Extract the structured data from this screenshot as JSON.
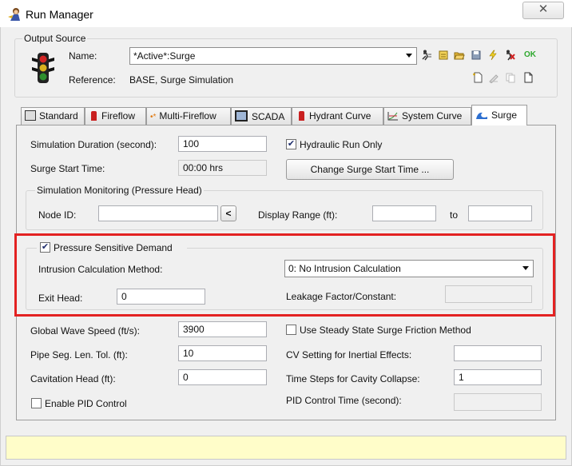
{
  "window": {
    "title": "Run Manager",
    "close_glyph": "✕"
  },
  "output_source": {
    "legend": "Output Source",
    "name_label": "Name:",
    "name_value": "*Active*:Surge",
    "reference_label": "Reference:",
    "reference_value": "BASE, Surge Simulation",
    "ok_label": "OK"
  },
  "tabs": [
    {
      "label": "Standard",
      "icon": "calculator-icon"
    },
    {
      "label": "Fireflow",
      "icon": "hydrant-icon"
    },
    {
      "label": "Multi-Fireflow",
      "icon": "multi-fireflow-icon"
    },
    {
      "label": "SCADA",
      "icon": "monitor-icon"
    },
    {
      "label": "Hydrant Curve",
      "icon": "hydrant-icon"
    },
    {
      "label": "System Curve",
      "icon": "chart-icon"
    },
    {
      "label": "Surge",
      "icon": "wave-icon"
    }
  ],
  "surge": {
    "sim_duration_label": "Simulation Duration (second):",
    "sim_duration_value": "100",
    "hydraulic_only_label": "Hydraulic Run Only",
    "surge_start_label": "Surge Start Time:",
    "surge_start_value": "00:00 hrs",
    "change_start_button": "Change Surge Start Time ...",
    "monitoring_legend": "Simulation Monitoring (Pressure Head)",
    "node_id_label": "Node ID:",
    "node_id_button": "<",
    "display_range_label": "Display Range (ft):",
    "to_label": "to",
    "psd_label": "Pressure Sensitive Demand",
    "intrusion_label": "Intrusion Calculation Method:",
    "intrusion_value": "0: No Intrusion Calculation",
    "exit_head_label": "Exit Head:",
    "exit_head_value": "0",
    "leakage_label": "Leakage Factor/Constant:",
    "wave_speed_label": "Global Wave Speed (ft/s):",
    "wave_speed_value": "3900",
    "steady_friction_label": "Use Steady State Surge Friction Method",
    "pipe_seg_label": "Pipe Seg. Len. Tol. (ft):",
    "pipe_seg_value": "10",
    "cv_setting_label": "CV Setting for Inertial Effects:",
    "cavitation_label": "Cavitation Head (ft):",
    "cavitation_value": "0",
    "time_steps_label": "Time Steps for Cavity Collapse:",
    "time_steps_value": "1",
    "pid_enable_label": "Enable PID Control",
    "pid_time_label": "PID Control Time (second):"
  },
  "colors": {
    "highlight": "#e32222",
    "status_bar": "#fffdc9",
    "ok_green": "#2fa82f"
  }
}
